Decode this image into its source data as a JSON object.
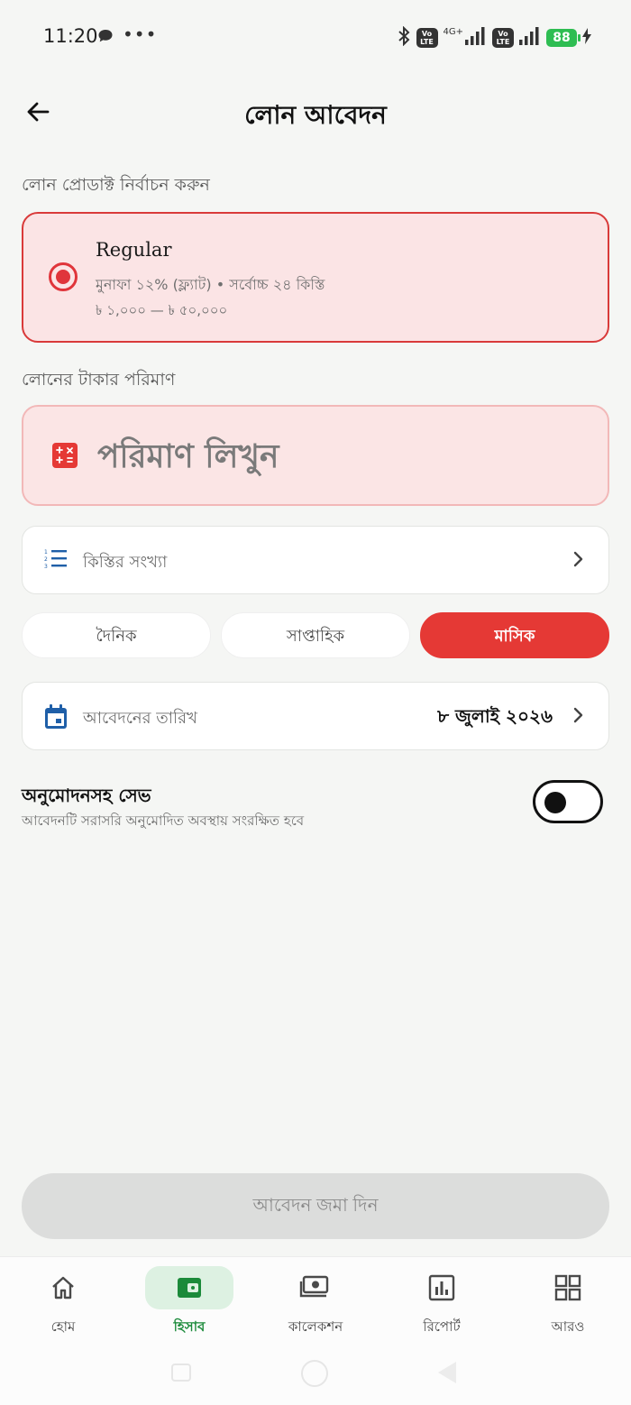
{
  "status_bar": {
    "time": "11:20",
    "dots": "•••",
    "network_label": "4G+",
    "lte_label": "Vo LTE",
    "battery": "88"
  },
  "header": {
    "title": "লোন আবেদন"
  },
  "product_section": {
    "label": "লোন প্রোডাক্ট নির্বাচন করুন",
    "selected": {
      "name": "Regular",
      "detail": "মুনাফা ১২% (ফ্ল্যাট) • সর্বোচ্চ ২৪ কিস্তি",
      "range": "৳ ১,০০০ — ৳ ৫০,০০০"
    }
  },
  "amount_section": {
    "label": "লোনের টাকার পরিমাণ",
    "placeholder": "পরিমাণ লিখুন"
  },
  "installments": {
    "label": "কিস্তির সংখ্যা"
  },
  "frequency": {
    "options": [
      "দৈনিক",
      "সাপ্তাহিক",
      "মাসিক"
    ],
    "selected": "মাসিক"
  },
  "apply_date": {
    "label": "আবেদনের তারিখ",
    "value": "৮ জুলাই ২০২৬"
  },
  "approval": {
    "title": "অনুমোদনসহ সেভ",
    "subtitle": "আবেদনটি সরাসরি অনুমোদিত অবস্থায় সংরক্ষিত হবে",
    "enabled": false
  },
  "submit": {
    "label": "আবেদন জমা দিন"
  },
  "bottom_nav": {
    "items": [
      {
        "label": "হোম",
        "icon": "home-icon"
      },
      {
        "label": "হিসাব",
        "icon": "wallet-icon",
        "active": true
      },
      {
        "label": "কালেকশন",
        "icon": "collection-icon"
      },
      {
        "label": "রিপোর্ট",
        "icon": "report-icon"
      },
      {
        "label": "আরও",
        "icon": "grid-icon"
      }
    ]
  },
  "colors": {
    "accent": "#e53935",
    "nav_active": "#1b8a3a",
    "card_bg": "#fbe4e5"
  }
}
